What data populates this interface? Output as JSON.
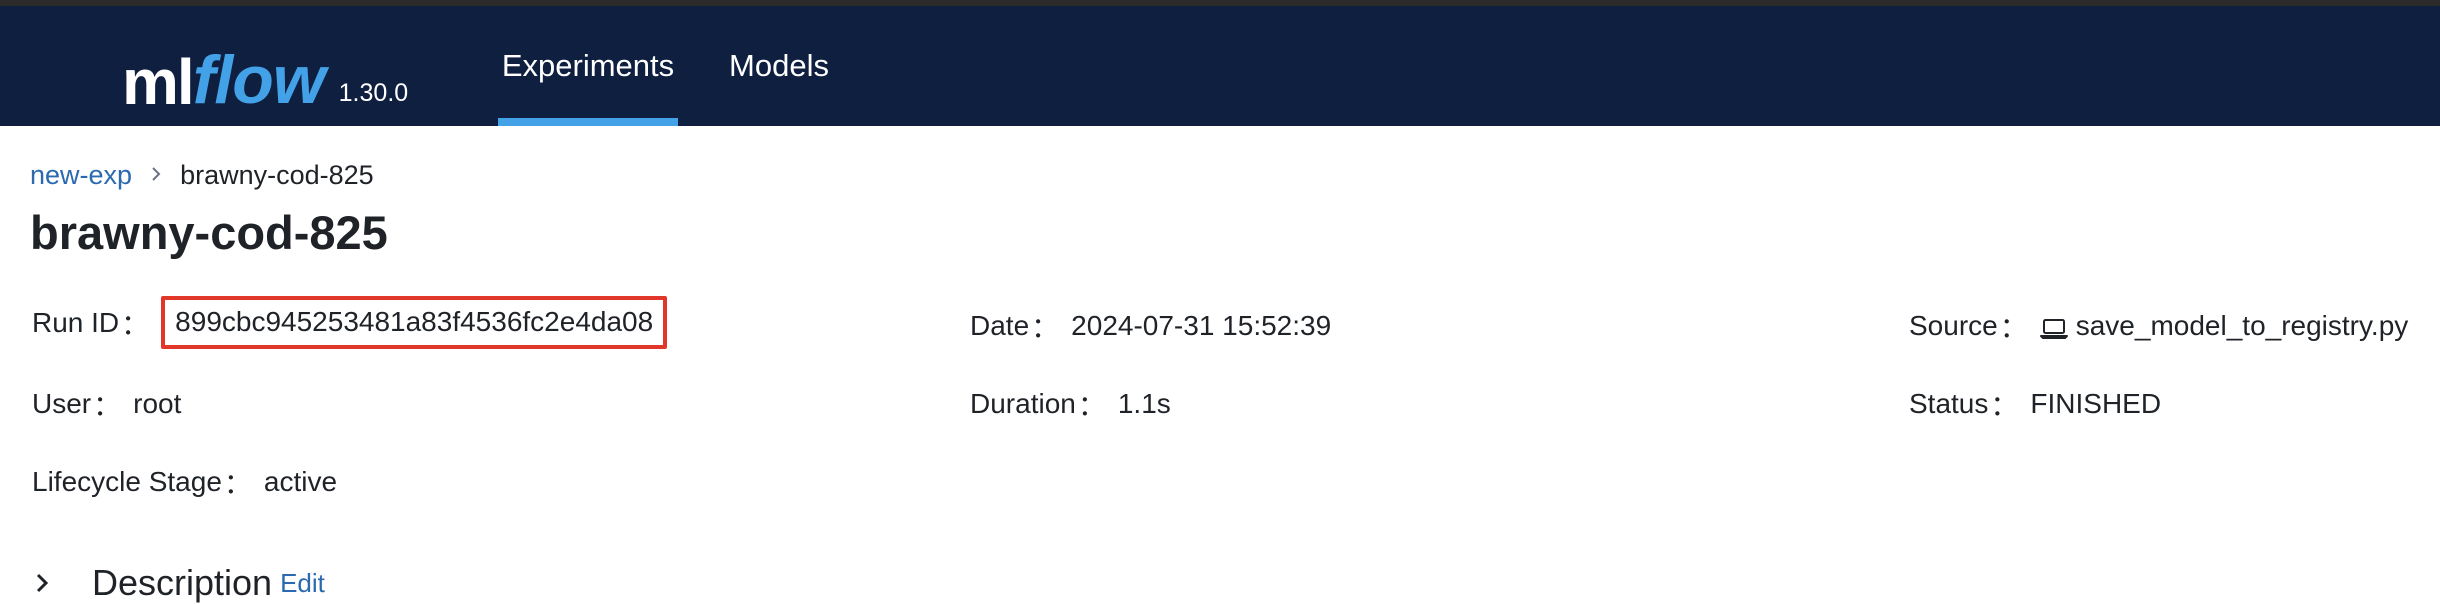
{
  "navbar": {
    "logo_ml": "ml",
    "logo_flow": "flow",
    "version": "1.30.0",
    "tabs": [
      {
        "label": "Experiments",
        "active": true
      },
      {
        "label": "Models",
        "active": false
      }
    ],
    "accent_color": "#43a1e8",
    "background_color": "#0f1f40"
  },
  "breadcrumb": {
    "parent": "new-exp",
    "current": "brawny-cod-825"
  },
  "page_title": "brawny-cod-825",
  "run_info": {
    "run_id": {
      "label": "Run ID",
      "value": "899cbc945253481a83f4536fc2e4da08"
    },
    "date": {
      "label": "Date",
      "value": "2024-07-31 15:52:39"
    },
    "source": {
      "label": "Source",
      "value": "save_model_to_registry.py",
      "icon": "laptop-icon"
    },
    "user": {
      "label": "User",
      "value": "root"
    },
    "duration": {
      "label": "Duration",
      "value": "1.1s"
    },
    "status": {
      "label": "Status",
      "value": "FINISHED"
    },
    "lifecycle_stage": {
      "label": "Lifecycle Stage",
      "value": "active"
    },
    "colon": "："
  },
  "description": {
    "label": "Description",
    "edit_label": "Edit"
  },
  "highlight_color": "#e1372b"
}
